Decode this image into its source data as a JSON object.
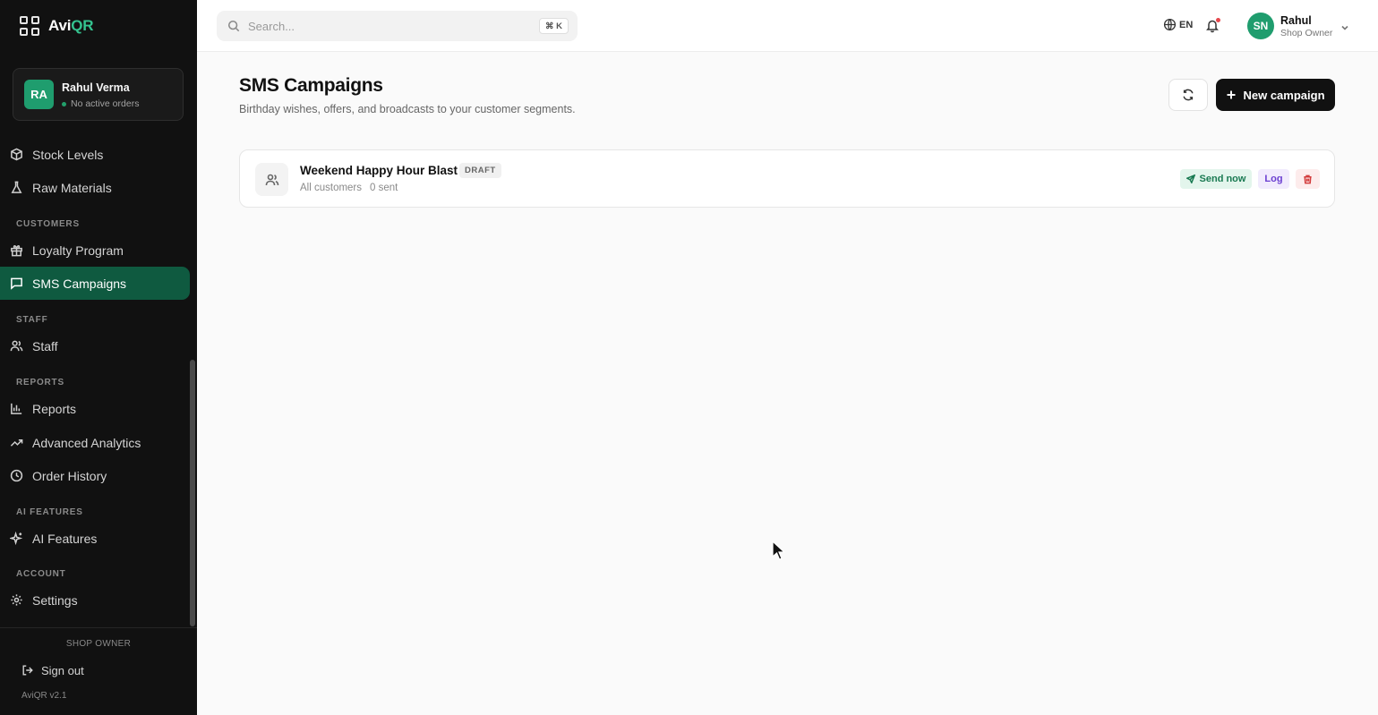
{
  "brand": {
    "prefix": "Avi",
    "suffix": "QR",
    "accent": "#34c38f"
  },
  "user_card": {
    "initials": "RA",
    "name": "Rahul Verma",
    "status": "No active orders"
  },
  "sidebar": {
    "items": [
      {
        "label": "Stock Levels",
        "icon": "box-icon"
      },
      {
        "label": "Raw Materials",
        "icon": "flask-icon"
      },
      {
        "label": "Loyalty Program",
        "icon": "gift-icon"
      },
      {
        "label": "SMS Campaigns",
        "icon": "message-icon",
        "active": true
      },
      {
        "label": "Staff",
        "icon": "users-icon"
      },
      {
        "label": "Reports",
        "icon": "bar-chart-icon"
      },
      {
        "label": "Advanced Analytics",
        "icon": "trending-up-icon"
      },
      {
        "label": "Order History",
        "icon": "clock-icon"
      },
      {
        "label": "AI Features",
        "icon": "sparkles-icon"
      },
      {
        "label": "Settings",
        "icon": "gear-icon"
      }
    ],
    "sections": [
      "CUSTOMERS",
      "STAFF",
      "REPORTS",
      "AI FEATURES",
      "ACCOUNT"
    ],
    "footer": {
      "role": "SHOP OWNER",
      "signout": "Sign out",
      "version": "AviQR v2.1"
    },
    "active_color": "#0f5a40"
  },
  "topbar": {
    "search_placeholder": "Search...",
    "shortcut": "⌘ K",
    "language": "EN",
    "avatar_initials": "SN",
    "user_name": "Rahul",
    "user_role": "Shop Owner"
  },
  "page": {
    "title": "SMS Campaigns",
    "subtitle": "Birthday wishes, offers, and broadcasts to your customer segments.",
    "new_button": "New campaign"
  },
  "campaigns": [
    {
      "name": "Weekend Happy Hour Blast",
      "status": "DRAFT",
      "audience": "All customers",
      "sent": "0 sent",
      "actions": {
        "send": "Send now",
        "log": "Log"
      }
    }
  ]
}
